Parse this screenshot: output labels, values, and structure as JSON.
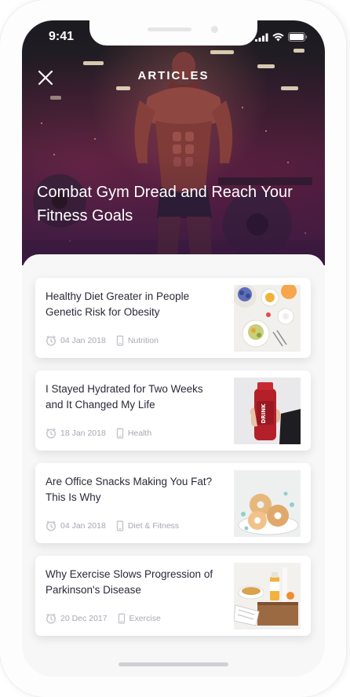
{
  "status_bar": {
    "time": "9:41"
  },
  "header": {
    "title": "ARTICLES",
    "close_icon": "close-icon"
  },
  "hero": {
    "title": "Combat Gym Dread and Reach Your Fitness Goals"
  },
  "articles": [
    {
      "title": "Healthy Diet Greater in People Genetic Risk for Obesity",
      "date": "04 Jan 2018",
      "category": "Nutrition",
      "thumbnail": "healthy-breakfast-thumbnail"
    },
    {
      "title": "I Stayed Hydrated for Two Weeks and It Changed My Life",
      "date": "18 Jan 2018",
      "category": "Health",
      "thumbnail": "juice-bottle-thumbnail"
    },
    {
      "title": "Are Office Snacks Making You Fat? This Is Why",
      "date": "04 Jan 2018",
      "category": "Diet & Fitness",
      "thumbnail": "donuts-thumbnail"
    },
    {
      "title": "Why Exercise Slows Progression of Parkinson's Disease",
      "date": "20 Dec 2017",
      "category": "Exercise",
      "thumbnail": "breakfast-tray-thumbnail"
    }
  ],
  "colors": {
    "card_title": "#2a2a3a",
    "meta": "#a7a7b3",
    "background": "#f7f7f8",
    "hero_overlay": "#4a2550"
  }
}
